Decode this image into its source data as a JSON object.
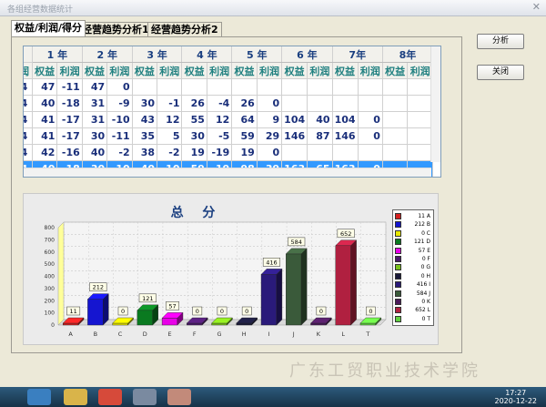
{
  "window": {
    "title": "各组经营数据统计",
    "close": "✕"
  },
  "tabs": [
    "权益/利润/得分",
    "经营趋势分析1",
    "经营趋势分析2"
  ],
  "buttons": {
    "analyze": "分析",
    "close": "关闭"
  },
  "grid": {
    "years": [
      "1 年",
      "2 年",
      "3 年",
      "4 年",
      "5 年",
      "6 年",
      "7年",
      "8年"
    ],
    "first_header": "润",
    "subheaders": [
      "权益",
      "利润"
    ],
    "rows": [
      [
        "4",
        "47",
        "-11",
        "47",
        "0",
        "",
        "",
        "",
        "",
        "",
        "",
        "",
        "",
        "",
        "",
        "",
        ""
      ],
      [
        "4",
        "40",
        "-18",
        "31",
        "-9",
        "30",
        "-1",
        "26",
        "-4",
        "26",
        "0",
        "",
        "",
        "",
        "",
        "",
        ""
      ],
      [
        "4",
        "41",
        "-17",
        "31",
        "-10",
        "43",
        "12",
        "55",
        "12",
        "64",
        "9",
        "104",
        "40",
        "104",
        "0",
        "",
        ""
      ],
      [
        "4",
        "41",
        "-17",
        "30",
        "-11",
        "35",
        "5",
        "30",
        "-5",
        "59",
        "29",
        "146",
        "87",
        "146",
        "0",
        "",
        ""
      ],
      [
        "4",
        "42",
        "-16",
        "40",
        "-2",
        "38",
        "-2",
        "19",
        "-19",
        "19",
        "0",
        "",
        "",
        "",
        "",
        "",
        ""
      ],
      [
        "4",
        "40",
        "-18",
        "30",
        "-10",
        "40",
        "10",
        "59",
        "19",
        "98",
        "39",
        "163",
        "65",
        "163",
        "0",
        "",
        ""
      ]
    ],
    "selected_row": 5
  },
  "chart_data": {
    "type": "bar",
    "title": "总 分",
    "categories": [
      "A",
      "B",
      "C",
      "D",
      "E",
      "F",
      "G",
      "H",
      "I",
      "J",
      "K",
      "L",
      "T"
    ],
    "values": [
      11,
      212,
      0,
      121,
      57,
      0,
      0,
      0,
      416,
      584,
      0,
      652,
      0
    ],
    "colors": [
      "#d42020",
      "#1515d0",
      "#e8e800",
      "#0a7a20",
      "#e800e8",
      "#4a1a6a",
      "#7ac21c",
      "#1a1a3a",
      "#2a1a7a",
      "#3a5a3a",
      "#4a1a5a",
      "#b02040",
      "#60d040"
    ],
    "ylim": [
      0,
      800
    ],
    "yticks": [
      0,
      100,
      200,
      300,
      400,
      500,
      600,
      700,
      800
    ],
    "legend": [
      "11 A",
      "212 B",
      "0 C",
      "121 D",
      "57 E",
      "0 F",
      "0 G",
      "0 H",
      "416 I",
      "584 J",
      "0 K",
      "652 L",
      "0 T"
    ]
  },
  "watermark": "广东工贸职业技术学院",
  "taskbar": {
    "time": "17:27",
    "date": "2020-12-22"
  }
}
